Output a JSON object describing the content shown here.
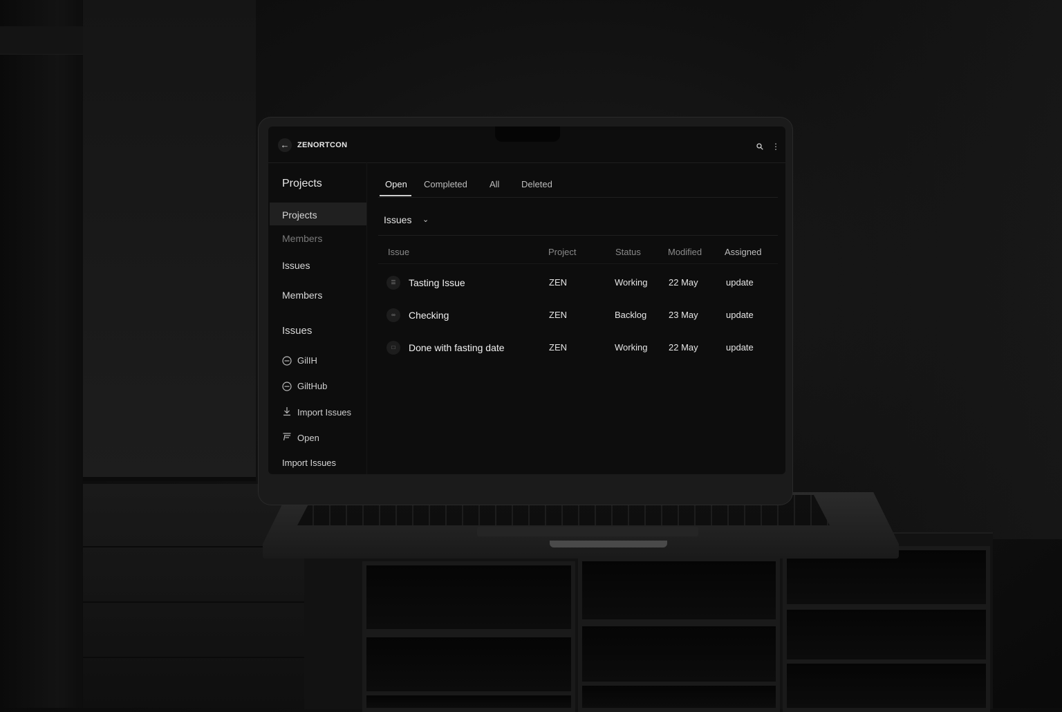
{
  "app": {
    "title": "ZENORTCON"
  },
  "sidebar": {
    "header": "Projects",
    "items": [
      {
        "label": "Projects",
        "active": true
      },
      {
        "label": "Members",
        "dim": true
      },
      {
        "label": "Issues"
      },
      {
        "label": "Members"
      },
      {
        "label": "Issues"
      }
    ],
    "icon_items": [
      {
        "label": "GilIH",
        "icon": "circle-minus-icon"
      },
      {
        "label": "GiltHub",
        "icon": "circle-minus-icon"
      },
      {
        "label": "Import Issues",
        "icon": "download-icon"
      },
      {
        "label": "Open",
        "icon": "list-flag-icon"
      }
    ],
    "footer_item": "Import Issues"
  },
  "tabs": [
    {
      "label": "Open",
      "active": true
    },
    {
      "label": "Completed"
    },
    {
      "label": "All"
    },
    {
      "label": "Deleted"
    }
  ],
  "filter": {
    "label": "Issues"
  },
  "table": {
    "columns": [
      "Issue",
      "Project",
      "Status",
      "Modified",
      "Assigned"
    ],
    "rows": [
      {
        "title": "Tasting Issue",
        "project": "ZEN",
        "status": "Working",
        "modified": "22 May",
        "assigned": "update"
      },
      {
        "title": "Checking",
        "project": "ZEN",
        "status": "Backlog",
        "modified": "23 May",
        "assigned": "update"
      },
      {
        "title": "Done with fasting date",
        "project": "ZEN",
        "status": "Working",
        "modified": "22 May",
        "assigned": "update"
      }
    ]
  }
}
